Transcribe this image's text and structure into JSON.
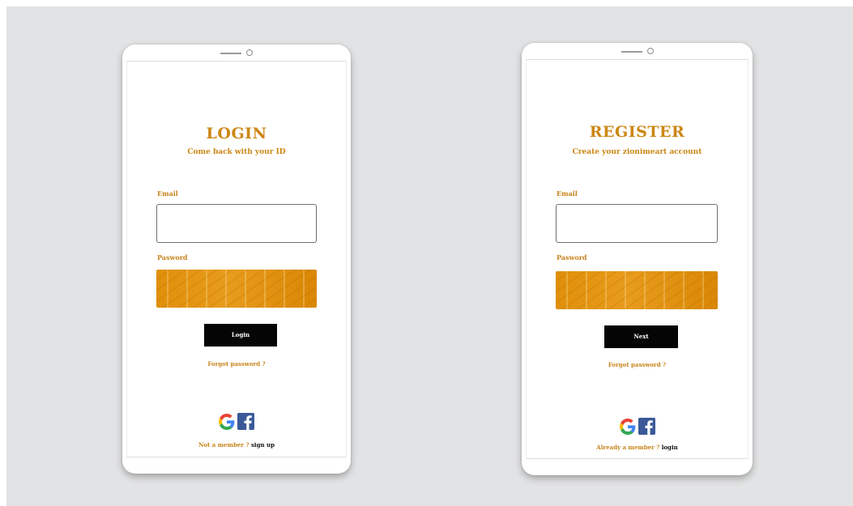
{
  "login": {
    "title": "LOGIN",
    "subtitle": "Come back with your ID",
    "email_label": "Email",
    "email_value": "",
    "password_label": "Pasword",
    "password_value": "",
    "button_label": "Login",
    "forgot_label": "Forgot password ?",
    "footer_prompt": "Not a member ?",
    "footer_link": "sign up"
  },
  "register": {
    "title": "REGISTER",
    "subtitle": "Create  your zionimeart account",
    "email_label": "Email",
    "email_value": "",
    "password_label": "Pasword",
    "password_value": "",
    "button_label": "Next",
    "forgot_label": "Forgot password ?",
    "footer_prompt": "Already a member ?",
    "footer_link": "login"
  },
  "social_icons": [
    "google-icon",
    "facebook-icon"
  ],
  "colors": {
    "accent": "#cc8714",
    "password_fill": "#e49108",
    "button": "#050505",
    "backdrop": "#e2e3e4",
    "facebook": "#3b5998"
  }
}
